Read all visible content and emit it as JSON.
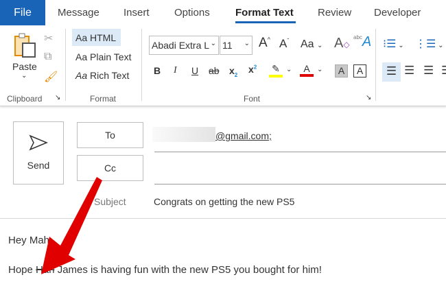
{
  "tabs": [
    "File",
    "Message",
    "Insert",
    "Options",
    "Format Text",
    "Review",
    "Developer"
  ],
  "active_tab": "Format Text",
  "clipboard": {
    "paste": "Paste",
    "label": "Clipboard"
  },
  "format": {
    "html": "HTML",
    "plain": "Plain Text",
    "rich": "Rich Text",
    "aa": "Aa",
    "label": "Format"
  },
  "font": {
    "name": "Abadi Extra L",
    "size": "11",
    "label": "Font",
    "bold": "B",
    "italic": "I",
    "underline": "U",
    "strike": "ab",
    "sub": "x",
    "sup": "x",
    "change_case": "Aa",
    "grow": "A",
    "shrink": "A",
    "shade": "A",
    "border": "A",
    "highlight_color": "#ffff00",
    "font_color": "#e00000"
  },
  "compose": {
    "send": "Send",
    "to": "To",
    "cc": "Cc",
    "subject_label": "Subject",
    "to_value": "@gmail.com;",
    "subject_value": "Congrats on getting the new PS5"
  },
  "body": {
    "greeting": "Hey Mah",
    "line_before": "Hope ",
    "struck": "Hari",
    "line_after": " James is having fun with the new PS5 you bought for him!"
  },
  "colors": {
    "accent": "#1a64b8",
    "arrow": "#e00000"
  }
}
